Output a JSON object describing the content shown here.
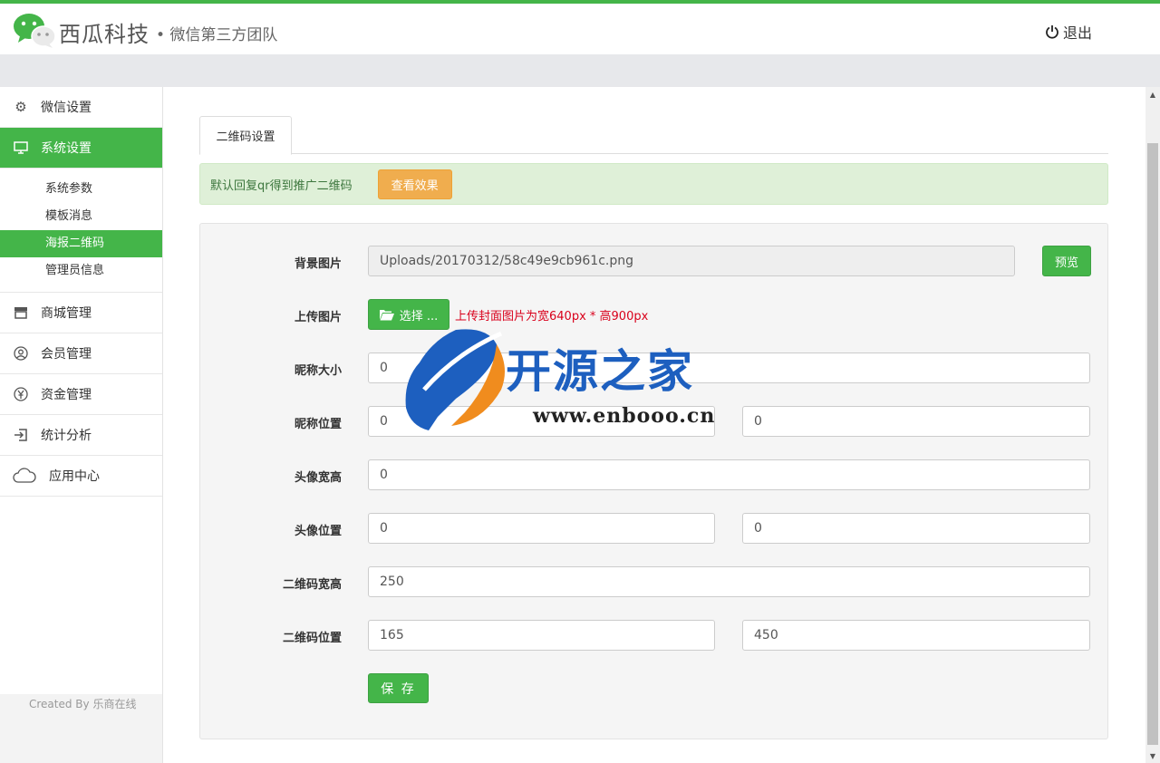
{
  "header": {
    "brand": "西瓜科技",
    "brand_sub": "• 微信第三方团队",
    "logout_label": "退出"
  },
  "sidebar": {
    "items": [
      {
        "label": "微信设置",
        "icon": "gear-icon"
      },
      {
        "label": "系统设置",
        "icon": "monitor-icon"
      },
      {
        "label": "商城管理",
        "icon": "store-icon"
      },
      {
        "label": "会员管理",
        "icon": "user-icon"
      },
      {
        "label": "资金管理",
        "icon": "yen-icon"
      },
      {
        "label": "统计分析",
        "icon": "signin-icon"
      },
      {
        "label": "应用中心",
        "icon": "cloud-icon"
      }
    ],
    "subitems": [
      "系统参数",
      "模板消息",
      "海报二维码",
      "管理员信息"
    ],
    "created_by": "Created By 乐商在线"
  },
  "main": {
    "tab_label": "二维码设置",
    "alert_text": "默认回复qr得到推广二维码",
    "view_effect_label": "查看效果",
    "form": {
      "bg_image_label": "背景图片",
      "bg_image_value": "Uploads/20170312/58c49e9cb961c.png",
      "preview_label": "预览",
      "upload_label": "上传图片",
      "choose_label": "选择 ...",
      "upload_hint": "上传封面图片为宽640px * 高900px",
      "nick_size_label": "昵称大小",
      "nick_size_value": "0",
      "nick_pos_label": "昵称位置",
      "nick_pos_x": "0",
      "nick_pos_y": "0",
      "avatar_size_label": "头像宽高",
      "avatar_size_value": "0",
      "avatar_pos_label": "头像位置",
      "avatar_pos_x": "0",
      "avatar_pos_y": "0",
      "qr_size_label": "二维码宽高",
      "qr_size_value": "250",
      "qr_pos_label": "二维码位置",
      "qr_pos_x": "165",
      "qr_pos_y": "450",
      "save_label": "保 存"
    }
  },
  "watermark": {
    "text": "开源之家",
    "url": "www.enbooo.cn"
  },
  "colors": {
    "accent": "#44b549",
    "warning": "#f0ad4e",
    "hint_red": "#d9001b"
  }
}
